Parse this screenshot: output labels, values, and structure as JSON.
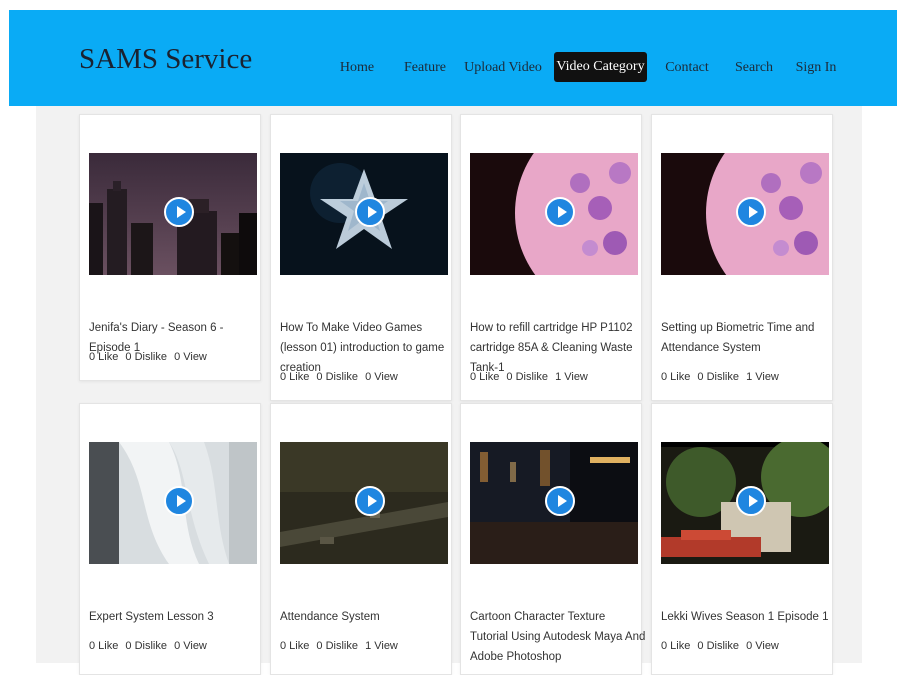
{
  "header": {
    "brand": "SAMS Service",
    "nav": [
      {
        "label": "Home"
      },
      {
        "label": "Feature"
      },
      {
        "label": "Upload Video"
      },
      {
        "label": "Video Category",
        "active": true
      },
      {
        "label": "Contact"
      },
      {
        "label": "Search"
      },
      {
        "label": "Sign In"
      }
    ]
  },
  "videos": [
    {
      "title": "Jenifa's Diary - Season 6 - Episode 1",
      "likes": "0 Like",
      "dislikes": "0 Dislike",
      "views": "0 View"
    },
    {
      "title": "How To Make Video Games (lesson 01) introduction to game creation",
      "likes": "0 Like",
      "dislikes": "0 Dislike",
      "views": "0 View"
    },
    {
      "title": "How to refill cartridge HP P1102 cartridge 85A & Cleaning Waste Tank-1",
      "likes": "0 Like",
      "dislikes": "0 Dislike",
      "views": "1 View"
    },
    {
      "title": "Setting up Biometric Time and Attendance System",
      "likes": "0 Like",
      "dislikes": "0 Dislike",
      "views": "1 View"
    },
    {
      "title": "Expert System Lesson 3",
      "likes": "0 Like",
      "dislikes": "0 Dislike",
      "views": "0 View"
    },
    {
      "title": "Attendance System",
      "likes": "0 Like",
      "dislikes": "0 Dislike",
      "views": "1 View"
    },
    {
      "title": "Cartoon Character Texture Tutorial Using Autodesk Maya And Adobe Photoshop",
      "likes": "",
      "dislikes": "",
      "views": ""
    },
    {
      "title": "Lekki Wives Season 1 Episode 1",
      "likes": "0 Like",
      "dislikes": "0 Dislike",
      "views": "0 View"
    }
  ],
  "colors": {
    "navbar": "#0aabf5",
    "active_nav_bg": "#111111",
    "play_button": "#1f86e0",
    "panel_bg": "#f2f2f2"
  },
  "icons": {
    "thumbnail_overlay": "play-icon"
  }
}
